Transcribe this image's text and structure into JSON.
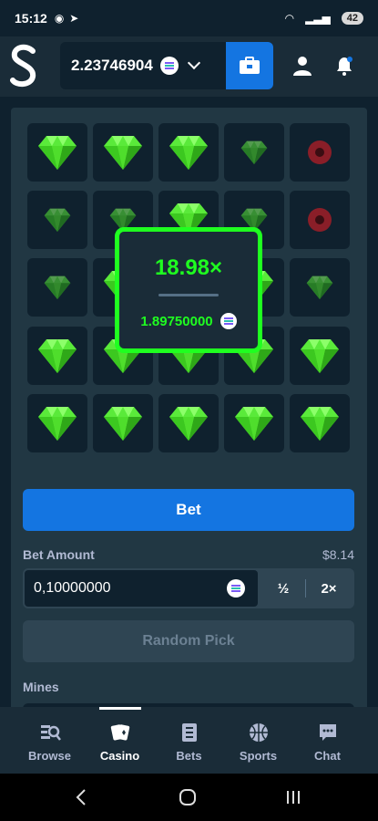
{
  "status_bar": {
    "time": "15:12",
    "battery": "42"
  },
  "header": {
    "balance": "2.23746904",
    "currency_icon": "solana-coin-icon",
    "wallet_icon": "wallet-icon",
    "user_icon": "user-icon",
    "bell_icon": "bell-icon"
  },
  "game": {
    "grid": [
      [
        "gem",
        "gem",
        "gem",
        "gem-dim",
        "mine"
      ],
      [
        "gem-dim",
        "gem-dim",
        "gem",
        "gem-dim",
        "mine"
      ],
      [
        "gem-dim",
        "gem",
        "gem",
        "gem",
        "gem-dim"
      ],
      [
        "gem",
        "gem",
        "gem",
        "gem",
        "gem"
      ],
      [
        "gem",
        "gem",
        "gem",
        "gem",
        "gem"
      ]
    ],
    "result": {
      "multiplier": "18.98×",
      "payout": "1.89750000"
    }
  },
  "controls": {
    "bet_label": "Bet",
    "bet_amount_label": "Bet Amount",
    "bet_amount_usd": "$8.14",
    "bet_amount_value": "0,10000000",
    "half_label": "½",
    "double_label": "2×",
    "random_pick_label": "Random Pick",
    "mines_label": "Mines"
  },
  "nav": {
    "items": [
      {
        "label": "Browse",
        "icon": "browse-icon"
      },
      {
        "label": "Casino",
        "icon": "casino-icon",
        "active": true
      },
      {
        "label": "Bets",
        "icon": "bets-icon"
      },
      {
        "label": "Sports",
        "icon": "sports-icon"
      },
      {
        "label": "Chat",
        "icon": "chat-icon"
      }
    ]
  },
  "colors": {
    "accent_green": "#1fff20",
    "accent_blue": "#1475e1",
    "bg_dark": "#0f212e",
    "panel": "#213743"
  }
}
